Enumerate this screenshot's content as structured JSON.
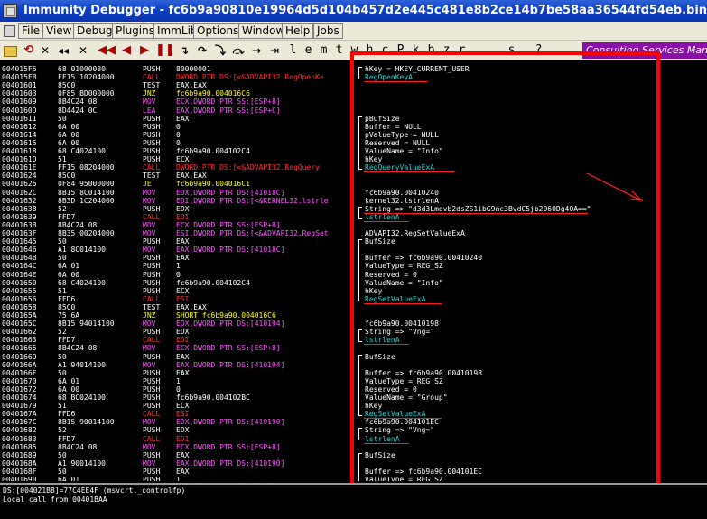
{
  "window": {
    "title": "Immunity Debugger - fc6b9a90810e19964d5d104b457d2e445c481e8b2ce14b7be58aa36544fd54eb.bin - [CPU - main thr"
  },
  "menu": [
    "File",
    "View",
    "Debug",
    "Plugins",
    "ImmLib",
    "Options",
    "Window",
    "Help",
    "Jobs"
  ],
  "toolbar": {
    "icons": [
      "open-folder-icon",
      "restart-icon",
      "close-icon",
      "rewind-icon",
      "back-icon",
      "run-icon",
      "pause-icon",
      "step-into-icon",
      "step-over-icon",
      "trace-into-icon",
      "trace-over-icon",
      "execute-till-return-icon",
      "goto-icon"
    ],
    "letters": [
      "l",
      "e",
      "m",
      "t",
      "w",
      "h",
      "c",
      "P",
      "k",
      "b",
      "z",
      "r",
      "...",
      "s",
      "?"
    ],
    "banner": "Consulting Services Manag"
  },
  "disassembly": [
    {
      "addr": "004015F6",
      "hex": "68 01000080",
      "mn": "PUSH",
      "ops": "80000001"
    },
    {
      "addr": "004015FB",
      "hex": "FF15 10204000",
      "mn": "CALL",
      "ops": "DWORD PTR DS:[<&ADVAPI32.RegOpenKe"
    },
    {
      "addr": "00401601",
      "hex": "85C0",
      "mn": "TEST",
      "ops": "EAX,EAX"
    },
    {
      "addr": "00401603",
      "hex": "0F85 BD000000",
      "mn": "JNZ",
      "ops": "fc6b9a90.004016C6"
    },
    {
      "addr": "00401609",
      "hex": "8B4C24 08",
      "mn": "MOV",
      "ops": "ECX,DWORD PTR SS:[ESP+8]"
    },
    {
      "addr": "0040160D",
      "hex": "8D4424 0C",
      "mn": "LEA",
      "ops": "EAX,DWORD PTR SS:[ESP+C]"
    },
    {
      "addr": "00401611",
      "hex": "50",
      "mn": "PUSH",
      "ops": "EAX"
    },
    {
      "addr": "00401612",
      "hex": "6A 00",
      "mn": "PUSH",
      "ops": "0"
    },
    {
      "addr": "00401614",
      "hex": "6A 00",
      "mn": "PUSH",
      "ops": "0"
    },
    {
      "addr": "00401616",
      "hex": "6A 00",
      "mn": "PUSH",
      "ops": "0"
    },
    {
      "addr": "00401618",
      "hex": "68 C4024100",
      "mn": "PUSH",
      "ops": "fc6b9a90.004102C4"
    },
    {
      "addr": "0040161D",
      "hex": "51",
      "mn": "PUSH",
      "ops": "ECX"
    },
    {
      "addr": "0040161E",
      "hex": "FF15 08204000",
      "mn": "CALL",
      "ops": "DWORD PTR DS:[<&ADVAPI32.RegQuery"
    },
    {
      "addr": "00401624",
      "hex": "85C0",
      "mn": "TEST",
      "ops": "EAX,EAX"
    },
    {
      "addr": "00401626",
      "hex": "0F84 95000000",
      "mn": "JE",
      "ops": "fc6b9a90.004016C1"
    },
    {
      "addr": "0040162C",
      "hex": "8B15 8C014100",
      "mn": "MOV",
      "ops": "EDX,DWORD PTR DS:[41018C]"
    },
    {
      "addr": "00401632",
      "hex": "8B3D 1C204000",
      "mn": "MOV",
      "ops": "EDI,DWORD PTR DS:[<&KERNEL32.lstrle"
    },
    {
      "addr": "00401638",
      "hex": "52",
      "mn": "PUSH",
      "ops": "EDX"
    },
    {
      "addr": "00401639",
      "hex": "FFD7",
      "mn": "CALL",
      "ops": "EDI"
    },
    {
      "addr": "0040163B",
      "hex": "8B4C24 08",
      "mn": "MOV",
      "ops": "ECX,DWORD PTR SS:[ESP+8]"
    },
    {
      "addr": "0040163F",
      "hex": "8B35 00204000",
      "mn": "MOV",
      "ops": "ESI,DWORD PTR DS:[<&ADVAPI32.RegSet"
    },
    {
      "addr": "00401645",
      "hex": "50",
      "mn": "PUSH",
      "ops": "EAX"
    },
    {
      "addr": "00401646",
      "hex": "A1 8C014100",
      "mn": "MOV",
      "ops": "EAX,DWORD PTR DS:[41018C]"
    },
    {
      "addr": "0040164B",
      "hex": "50",
      "mn": "PUSH",
      "ops": "EAX"
    },
    {
      "addr": "0040164C",
      "hex": "6A 01",
      "mn": "PUSH",
      "ops": "1"
    },
    {
      "addr": "0040164E",
      "hex": "6A 00",
      "mn": "PUSH",
      "ops": "0"
    },
    {
      "addr": "00401650",
      "hex": "68 C4024100",
      "mn": "PUSH",
      "ops": "fc6b9a90.004102C4"
    },
    {
      "addr": "00401655",
      "hex": "51",
      "mn": "PUSH",
      "ops": "ECX"
    },
    {
      "addr": "00401656",
      "hex": "FFD6",
      "mn": "CALL",
      "ops": "ESI"
    },
    {
      "addr": "00401658",
      "hex": "85C0",
      "mn": "TEST",
      "ops": "EAX,EAX"
    },
    {
      "addr": "0040165A",
      "hex": "75 6A",
      "mn": "JNZ",
      "ops": "SHORT fc6b9a90.004016C6"
    },
    {
      "addr": "0040165C",
      "hex": "8B15 94014100",
      "mn": "MOV",
      "ops": "EDX,DWORD PTR DS:[410194]"
    },
    {
      "addr": "00401662",
      "hex": "52",
      "mn": "PUSH",
      "ops": "EDX"
    },
    {
      "addr": "00401663",
      "hex": "FFD7",
      "mn": "CALL",
      "ops": "EDI"
    },
    {
      "addr": "00401665",
      "hex": "8B4C24 08",
      "mn": "MOV",
      "ops": "ECX,DWORD PTR SS:[ESP+8]"
    },
    {
      "addr": "00401669",
      "hex": "50",
      "mn": "PUSH",
      "ops": "EAX"
    },
    {
      "addr": "0040166A",
      "hex": "A1 94014100",
      "mn": "MOV",
      "ops": "EAX,DWORD PTR DS:[410194]"
    },
    {
      "addr": "0040166F",
      "hex": "50",
      "mn": "PUSH",
      "ops": "EAX"
    },
    {
      "addr": "00401670",
      "hex": "6A 01",
      "mn": "PUSH",
      "ops": "1"
    },
    {
      "addr": "00401672",
      "hex": "6A 00",
      "mn": "PUSH",
      "ops": "0"
    },
    {
      "addr": "00401674",
      "hex": "68 BC024100",
      "mn": "PUSH",
      "ops": "fc6b9a90.004102BC"
    },
    {
      "addr": "00401679",
      "hex": "51",
      "mn": "PUSH",
      "ops": "ECX"
    },
    {
      "addr": "0040167A",
      "hex": "FFD6",
      "mn": "CALL",
      "ops": "ESI"
    },
    {
      "addr": "0040167C",
      "hex": "8B15 90014100",
      "mn": "MOV",
      "ops": "EDX,DWORD PTR DS:[410190]"
    },
    {
      "addr": "00401682",
      "hex": "52",
      "mn": "PUSH",
      "ops": "EDX"
    },
    {
      "addr": "00401683",
      "hex": "FFD7",
      "mn": "CALL",
      "ops": "EDI"
    },
    {
      "addr": "00401685",
      "hex": "8B4C24 08",
      "mn": "MOV",
      "ops": "ECX,DWORD PTR SS:[ESP+8]"
    },
    {
      "addr": "00401689",
      "hex": "50",
      "mn": "PUSH",
      "ops": "EAX"
    },
    {
      "addr": "0040168A",
      "hex": "A1 90014100",
      "mn": "MOV",
      "ops": "EAX,DWORD PTR DS:[410190]"
    },
    {
      "addr": "0040168F",
      "hex": "50",
      "mn": "PUSH",
      "ops": "EAX"
    },
    {
      "addr": "00401690",
      "hex": "6A 01",
      "mn": "PUSH",
      "ops": "1"
    }
  ],
  "comments": [
    {
      "row": 0,
      "text": "hKey = HKEY_CURRENT_USER"
    },
    {
      "row": 1,
      "text": "RegOpenKeyA",
      "api": true
    },
    {
      "row": 6,
      "text": "pBufSize"
    },
    {
      "row": 7,
      "text": "Buffer = NULL"
    },
    {
      "row": 8,
      "text": "pValueType = NULL"
    },
    {
      "row": 9,
      "text": "Reserved = NULL"
    },
    {
      "row": 10,
      "text": "ValueName = \"Info\""
    },
    {
      "row": 11,
      "text": "hKey"
    },
    {
      "row": 12,
      "text": "RegQueryValueExA",
      "api": true
    },
    {
      "row": 15,
      "text": "fc6b9a90.00410240"
    },
    {
      "row": 16,
      "text": "kernel32.lstrlenA"
    },
    {
      "row": 17,
      "text": "String => \"d3d3Lmdvb2dsZS1ibG9nc3BvdC5jb206ODg4OA==\""
    },
    {
      "row": 18,
      "text": "lstrlenA",
      "api": true
    },
    {
      "row": 20,
      "text": "ADVAPI32.RegSetValueExA"
    },
    {
      "row": 21,
      "text": "BufSize"
    },
    {
      "row": 23,
      "text": "Buffer => fc6b9a90.00410240"
    },
    {
      "row": 24,
      "text": "ValueType = REG_SZ"
    },
    {
      "row": 25,
      "text": "Reserved = 0"
    },
    {
      "row": 26,
      "text": "ValueName = \"Info\""
    },
    {
      "row": 27,
      "text": "hKey"
    },
    {
      "row": 28,
      "text": "RegSetValueExA",
      "api": true
    },
    {
      "row": 31,
      "text": "fc6b9a90.00410198"
    },
    {
      "row": 32,
      "text": "String => \"Vng=\""
    },
    {
      "row": 33,
      "text": "lstrlenA",
      "api": true
    },
    {
      "row": 35,
      "text": "BufSize"
    },
    {
      "row": 37,
      "text": "Buffer => fc6b9a90.00410198"
    },
    {
      "row": 38,
      "text": "ValueType = REG_SZ"
    },
    {
      "row": 39,
      "text": "Reserved = 0"
    },
    {
      "row": 40,
      "text": "ValueName = \"Group\""
    },
    {
      "row": 41,
      "text": "hKey"
    },
    {
      "row": 42,
      "text": "RegSetValueExA",
      "api": true
    },
    {
      "row": 43,
      "text": "fc6b9a90.004101EC"
    },
    {
      "row": 44,
      "text": "String => \"Vng=\""
    },
    {
      "row": 45,
      "text": "lstrlenA",
      "api": true
    },
    {
      "row": 47,
      "text": "BufSize"
    },
    {
      "row": 49,
      "text": "Buffer => fc6b9a90.004101EC"
    },
    {
      "row": 50,
      "text": "ValueType = REG_SZ"
    }
  ],
  "underlined_rows": [
    1,
    12,
    17,
    18,
    28,
    33,
    42,
    45
  ],
  "brackets": [
    [
      0,
      1
    ],
    [
      6,
      12
    ],
    [
      17,
      18
    ],
    [
      21,
      28
    ],
    [
      32,
      33
    ],
    [
      35,
      42
    ],
    [
      44,
      45
    ],
    [
      47,
      50
    ]
  ],
  "info_pane": {
    "line1": "DS:[004021B8]=77C4EE4F (msvcrt._controlfp)",
    "line2": "Local call from 00401BAA"
  },
  "colors": {
    "annotation": "#ff0000",
    "api_name": "#20d5d5"
  }
}
